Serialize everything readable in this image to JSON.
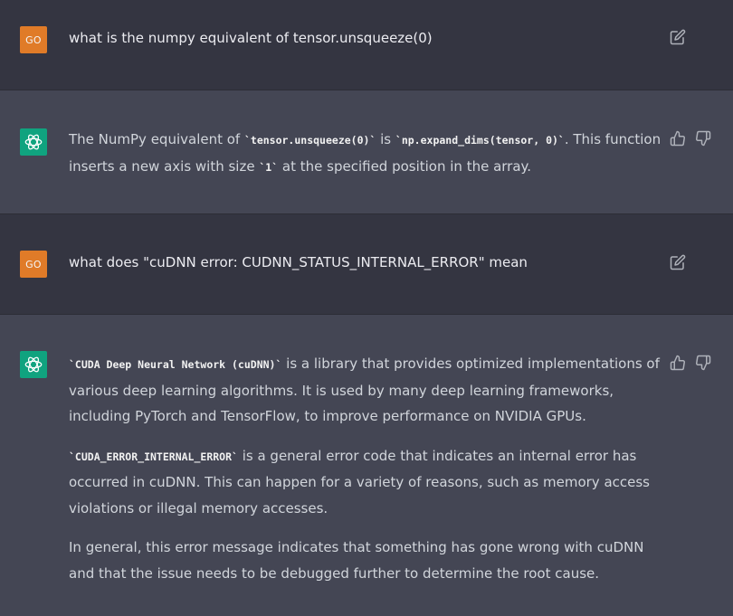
{
  "messages": [
    {
      "role": "user",
      "avatar_label": "GO",
      "text": "what is the numpy equivalent of tensor.unsqueeze(0)",
      "icons": [
        "edit-icon"
      ]
    },
    {
      "role": "assistant",
      "icons": [
        "chatgpt-logo-icon",
        "thumbs-up-icon",
        "thumbs-down-icon"
      ],
      "paragraphs": [
        {
          "t1": "The NumPy equivalent of ",
          "c1": "`tensor.unsqueeze(0)`",
          "t2": " is ",
          "c2": "`np.expand_dims(tensor, 0)`",
          "t3": ". This function inserts a new axis with size ",
          "c3": "`1`",
          "t4": " at the specified position in the array."
        }
      ]
    },
    {
      "role": "user",
      "avatar_label": "GO",
      "text": "what does \"cuDNN error: CUDNN_STATUS_INTERNAL_ERROR\" mean",
      "icons": [
        "edit-icon"
      ]
    },
    {
      "role": "assistant",
      "icons": [
        "chatgpt-logo-icon",
        "thumbs-up-icon",
        "thumbs-down-icon"
      ],
      "paragraphs": [
        {
          "c1": "`CUDA Deep Neural Network (cuDNN)`",
          "t1": " is a library that provides optimized implementations of various deep learning algorithms. It is used by many deep learning frameworks, including PyTorch and TensorFlow, to improve performance on NVIDIA GPUs."
        },
        {
          "c1": "`CUDA_ERROR_INTERNAL_ERROR`",
          "t1": " is a general error code that indicates an internal error has occurred in cuDNN. This can happen for a variety of reasons, such as memory access violations or illegal memory accesses."
        },
        {
          "t1": "In general, this error message indicates that something has gone wrong with cuDNN and that the issue needs to be debugged further to determine the root cause."
        }
      ]
    }
  ],
  "colors": {
    "user_bg": "#343541",
    "assistant_bg": "#444654",
    "user_avatar": "#e07b28",
    "bot_avatar": "#10a37f",
    "text": "#d1d5db"
  }
}
